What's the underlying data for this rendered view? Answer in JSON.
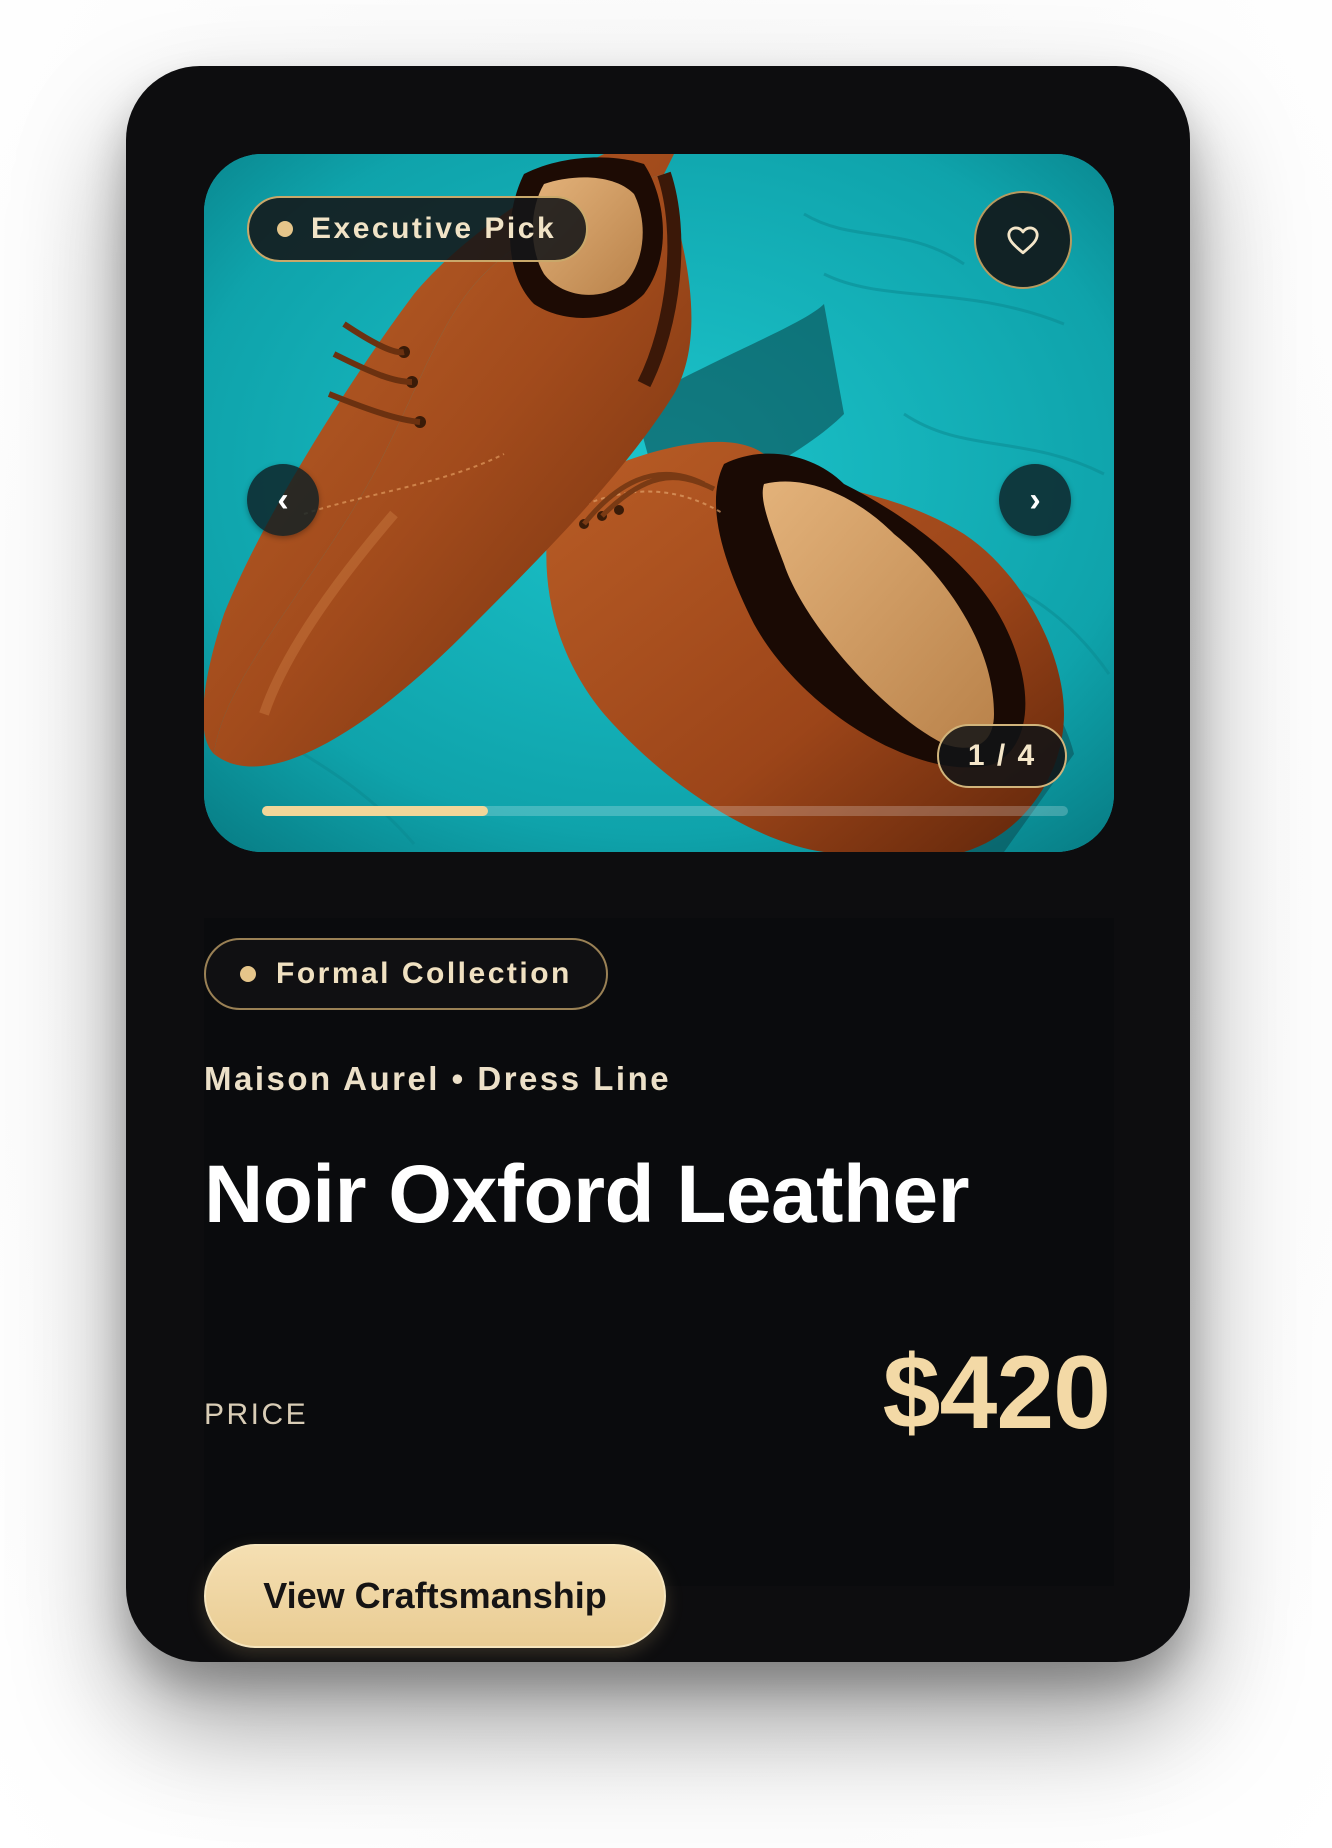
{
  "product_card": {
    "badge": {
      "label": "Executive Pick"
    },
    "favorite": {
      "icon": "heart-icon"
    },
    "gallery": {
      "prev_icon": "‹",
      "next_icon": "›",
      "counter": "1 / 4",
      "progress": 0.28
    },
    "collection": {
      "label": "Formal Collection"
    },
    "subtitle": "Maison Aurel • Dress Line",
    "title": "Noir Oxford Leather",
    "price": {
      "label": "PRICE",
      "value": "$420"
    },
    "cta": {
      "label": "View Craftsmanship"
    },
    "colors": {
      "card_bg": "#0d0d0f",
      "accent_gold": "#f3d9a6",
      "photo_bg": "#12aab3",
      "leather": "#a9501f"
    }
  }
}
